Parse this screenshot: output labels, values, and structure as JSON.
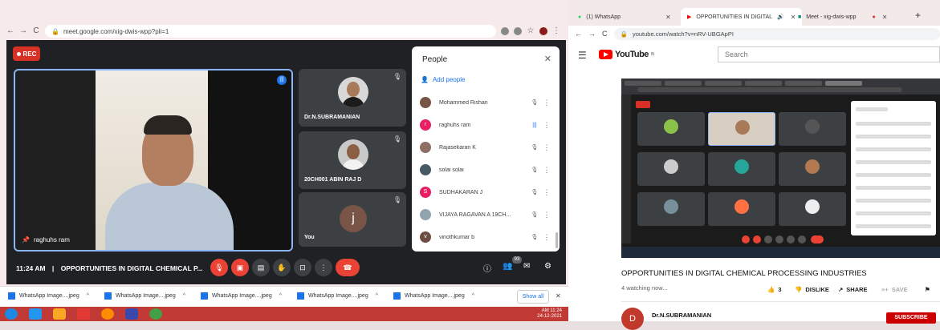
{
  "left_browser": {
    "url": "meet.google.com/xig-dwis-wpp?pli=1"
  },
  "meet": {
    "rec_label": "REC",
    "main_tile_name": "raghuhs ram",
    "tiles": [
      {
        "name": "Dr.N.SUBRAMANIAN"
      },
      {
        "name": "20CH001 ABIN RAJ D"
      },
      {
        "name": "You",
        "avatar_letter": "j"
      }
    ],
    "time": "11:24 AM",
    "separator": "|",
    "meeting_title": "OPPORTUNITIES IN DIGITAL CHEMICAL P...",
    "participant_count_badge": "93"
  },
  "people_panel": {
    "title": "People",
    "add_people": "Add people",
    "participants": [
      {
        "name": "Mohammed Rishan",
        "avatar_color": "#795548",
        "avatar_letter": ""
      },
      {
        "name": "raghuhs ram",
        "avatar_color": "#e91e63",
        "avatar_letter": "r"
      },
      {
        "name": "Rajasekaran K",
        "avatar_color": "#8d6e63",
        "avatar_letter": ""
      },
      {
        "name": "solai solai",
        "avatar_color": "#455a64",
        "avatar_letter": ""
      },
      {
        "name": "SUDHAKARAN J",
        "avatar_color": "#e91e63",
        "avatar_letter": "S"
      },
      {
        "name": "VIJAYA RAGAVAN A 19CH...",
        "avatar_color": "#90a4ae",
        "avatar_letter": ""
      },
      {
        "name": "vinothkumar b",
        "avatar_color": "#6d4c41",
        "avatar_letter": "v"
      }
    ]
  },
  "downloads": {
    "items": [
      "WhatsApp Image....jpeg",
      "WhatsApp Image....jpeg",
      "WhatsApp Image....jpeg",
      "WhatsApp Image....jpeg",
      "WhatsApp Image....jpeg"
    ],
    "show_all": "Show all"
  },
  "taskbar": {
    "time": "AM 11:24",
    "date": "24-12-2021"
  },
  "right_browser": {
    "tabs": [
      {
        "label": "(1) WhatsApp"
      },
      {
        "label": "OPPORTUNITIES IN DIGITAL"
      },
      {
        "label": "Meet - xig-dwis-wpp"
      }
    ],
    "url": "youtube.com/watch?v=nRV-UBGApPI"
  },
  "youtube": {
    "logo_text": "YouTube",
    "logo_region": "IN",
    "search_placeholder": "Search",
    "video_title": "OPPORTUNITIES IN DIGITAL CHEMICAL PROCESSING INDUSTRIES",
    "watching": "4 watching now...",
    "likes": "3",
    "dislike": "DISLIKE",
    "share": "SHARE",
    "save": "SAVE",
    "channel_name": "Dr.N.SUBRAMANIAN",
    "channel_avatar_letter": "D",
    "subscribe": "SUBSCRIBE"
  }
}
